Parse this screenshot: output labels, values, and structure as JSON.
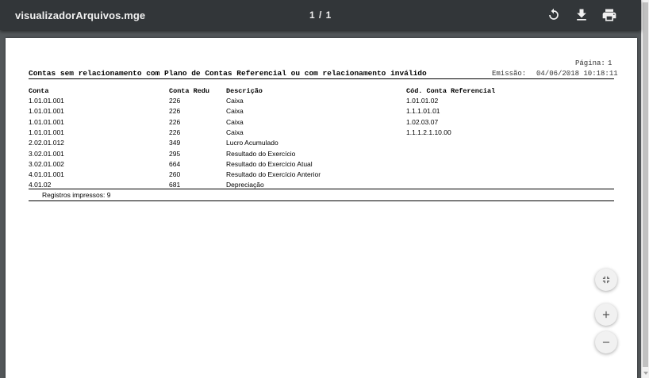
{
  "viewer": {
    "file_name": "visualizadorArquivos.mge",
    "page_indicator": "1 / 1",
    "icons": {
      "rotate": "rotate-icon",
      "download": "download-icon",
      "print": "print-icon",
      "fit": "fit-page-icon",
      "zoom_in": "zoom-in-icon",
      "zoom_out": "zoom-out-icon"
    }
  },
  "report": {
    "page_label": "Página:",
    "page_value": "1",
    "title": "Contas sem relacionamento com Plano de Contas Referencial ou com relacionamento inválido",
    "emission_label": "Emissão:",
    "emission_value": "04/06/2018 10:18:11",
    "columns": [
      "Conta",
      "Conta Redu",
      "Descrição",
      "Cód. Conta Referencial"
    ],
    "rows": [
      [
        "1.01.01.001",
        "226",
        "Caixa",
        "1.01.01.02"
      ],
      [
        "1.01.01.001",
        "226",
        "Caixa",
        "1.1.1.01.01"
      ],
      [
        "1.01.01.001",
        "226",
        "Caixa",
        "1.02.03.07"
      ],
      [
        "1.01.01.001",
        "226",
        "Caixa",
        "1.1.1.2.1.10.00"
      ],
      [
        "2.02.01.012",
        "349",
        "Lucro Acumulado",
        ""
      ],
      [
        "3.02.01.001",
        "295",
        "Resultado do Exercício",
        ""
      ],
      [
        "3.02.01.002",
        "664",
        "Resultado do Exercício Atual",
        ""
      ],
      [
        "4.01.01.001",
        "260",
        "Resultado do Exercício Anterior",
        ""
      ],
      [
        "4.01.02",
        "681",
        "Depreciação",
        ""
      ]
    ],
    "footer": "Registros impressos: 9"
  }
}
